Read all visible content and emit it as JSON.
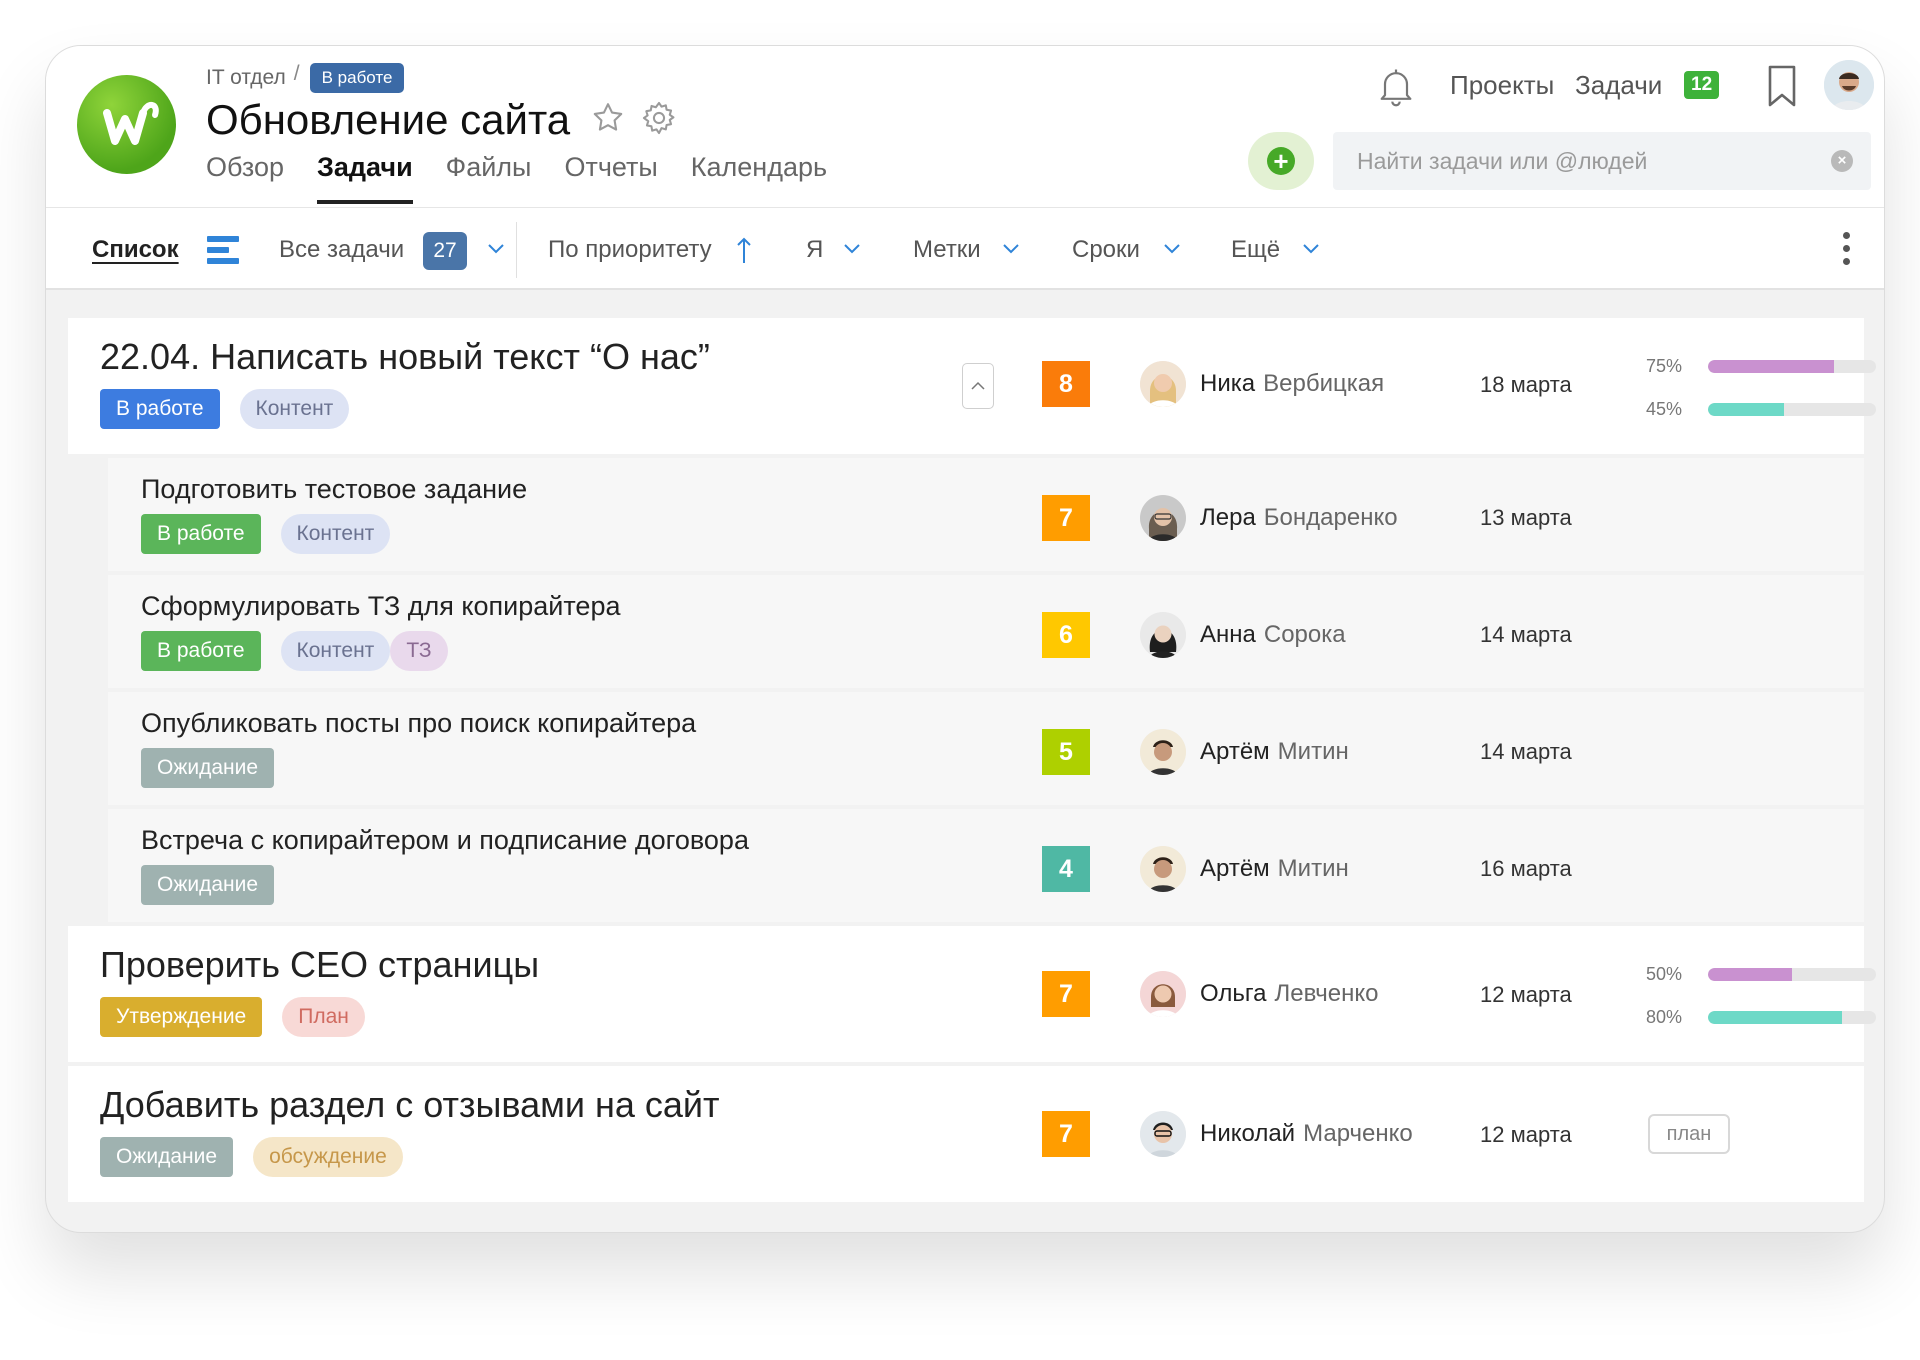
{
  "header": {
    "breadcrumb": {
      "parent": "IT отдел",
      "separator": "/",
      "status": "В работе"
    },
    "title": "Обновление сайта",
    "tabs": [
      {
        "label": "Обзор",
        "active": false
      },
      {
        "label": "Задачи",
        "active": true
      },
      {
        "label": "Файлы",
        "active": false
      },
      {
        "label": "Отчеты",
        "active": false
      },
      {
        "label": "Календарь",
        "active": false
      }
    ],
    "nav": {
      "projects": "Проекты",
      "tasks": "Задачи",
      "tasks_count": "12"
    },
    "search": {
      "placeholder": "Найти задачи или @людей",
      "value": ""
    },
    "icons": [
      "logo-icon",
      "star-icon",
      "gear-icon",
      "bell-icon",
      "bookmark-icon",
      "plus-icon",
      "clear-icon"
    ]
  },
  "toolbar": {
    "view_label": "Список",
    "all_tasks": "Все задачи",
    "all_tasks_count": "27",
    "sort": "По приоритету",
    "me": "Я",
    "labels": "Метки",
    "deadlines": "Сроки",
    "more": "Ещё"
  },
  "colors": {
    "status_in_progress_blue": "#3d7ce0",
    "status_in_progress_green": "#5bb55a",
    "status_waiting": "#9fb2b0",
    "status_approval": "#d9ae2e",
    "progress_purple": "#c991d0",
    "progress_teal": "#6dd9c7"
  },
  "tasks": [
    {
      "title": "22.04. Написать новый текст “О нас”",
      "status": "В работе",
      "tags": [
        "Контент"
      ],
      "priority": "8",
      "first_name": "Ника",
      "last_name": "Вербицкая",
      "date": "18 марта",
      "progress": [
        {
          "label": "75%",
          "value": 0.75
        },
        {
          "label": "45%",
          "value": 0.45
        }
      ],
      "subtasks": [
        {
          "title": "Подготовить тестовое задание",
          "status": "В работе",
          "tags": [
            "Контент"
          ],
          "priority": "7",
          "first_name": "Лера",
          "last_name": "Бондаренко",
          "date": "13 марта"
        },
        {
          "title": "Сформулировать ТЗ для копирайтера",
          "status": "В работе",
          "tags": [
            "Контент",
            "ТЗ"
          ],
          "priority": "6",
          "first_name": "Анна",
          "last_name": "Сорока",
          "date": "14 марта"
        },
        {
          "title": "Опубликовать посты про поиск копирайтера",
          "status": "Ожидание",
          "tags": [],
          "priority": "5",
          "first_name": "Артём",
          "last_name": "Митин",
          "date": "14 марта"
        },
        {
          "title": "Встреча с копирайтером и подписание договора",
          "status": "Ожидание",
          "tags": [],
          "priority": "4",
          "first_name": "Артём",
          "last_name": "Митин",
          "date": "16 марта"
        }
      ]
    },
    {
      "title": "Проверить СЕО страницы",
      "status": "Утверждение",
      "tags": [
        "План"
      ],
      "priority": "7",
      "first_name": "Ольга",
      "last_name": "Левченко",
      "date": "12 марта",
      "progress": [
        {
          "label": "50%",
          "value": 0.5
        },
        {
          "label": "80%",
          "value": 0.8
        }
      ]
    },
    {
      "title": "Добавить раздел с отзывами на сайт",
      "status": "Ожидание",
      "tags": [
        "обсуждение"
      ],
      "priority": "7",
      "first_name": "Николай",
      "last_name": "Марченко",
      "date": "12 марта",
      "plan_label": "план"
    }
  ]
}
